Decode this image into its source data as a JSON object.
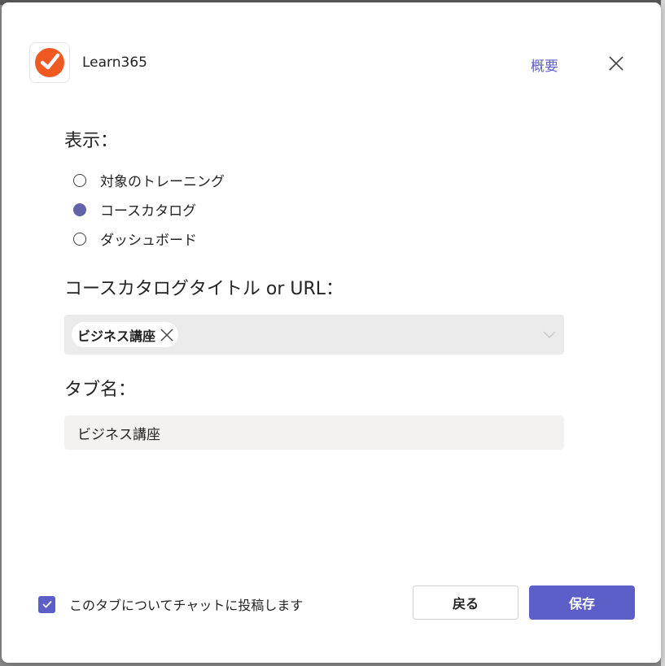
{
  "app": {
    "name": "Learn365",
    "about_label": "概要",
    "logo_color": "#f05a22"
  },
  "display": {
    "label": "表示：",
    "options": [
      {
        "label": "対象のトレーニング",
        "checked": false
      },
      {
        "label": "コースカタログ",
        "checked": true
      },
      {
        "label": "ダッシュボード",
        "checked": false
      }
    ]
  },
  "catalog": {
    "label": "コースカタログタイトル or URL：",
    "selected_chip": "ビジネス講座"
  },
  "tab_name": {
    "label": "タブ名：",
    "value": "ビジネス講座"
  },
  "footer": {
    "post_checkbox_label": "このタブについてチャットに投稿します",
    "post_checked": true,
    "back_label": "戻る",
    "save_label": "保存"
  },
  "colors": {
    "accent": "#5b5fc7",
    "radio_selected": "#6264a7"
  }
}
